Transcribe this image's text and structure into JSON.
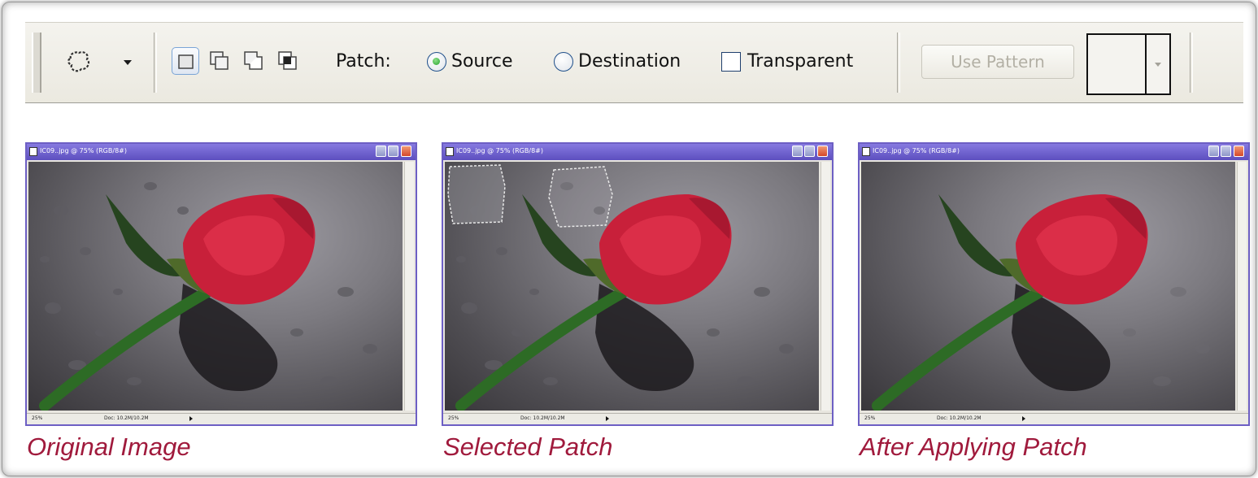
{
  "toolbar": {
    "tool_preset_icon": "patch-tool-icon",
    "mode_buttons": [
      {
        "name": "new-selection-icon",
        "active": true
      },
      {
        "name": "add-to-selection-icon",
        "active": false
      },
      {
        "name": "subtract-from-selection-icon",
        "active": false
      },
      {
        "name": "intersect-selection-icon",
        "active": false
      }
    ],
    "patch_label": "Patch:",
    "source_label": "Source",
    "source_selected": true,
    "destination_label": "Destination",
    "destination_selected": false,
    "transparent_label": "Transparent",
    "transparent_checked": false,
    "use_pattern_label": "Use Pattern",
    "use_pattern_enabled": false
  },
  "windows": [
    {
      "title": "IC09..jpg @ 75% (RGB/8#)",
      "status_zoom": "25%",
      "status_doc": "Doc: 10.2M/10.2M",
      "caption": "Original Image"
    },
    {
      "title": "IC09..jpg @ 75% (RGB/8#)",
      "status_zoom": "25%",
      "status_doc": "Doc: 10.2M/10.2M",
      "caption": "Selected Patch"
    },
    {
      "title": "IC09..jpg @ 75% (RGB/8#)",
      "status_zoom": "25%",
      "status_doc": "Doc: 10.2M/10.2M",
      "caption": "After Applying Patch"
    }
  ],
  "colors": {
    "caption": "#a01a3c",
    "titlebar": "#6d5fc4",
    "radio_selected": "#26a32e"
  }
}
